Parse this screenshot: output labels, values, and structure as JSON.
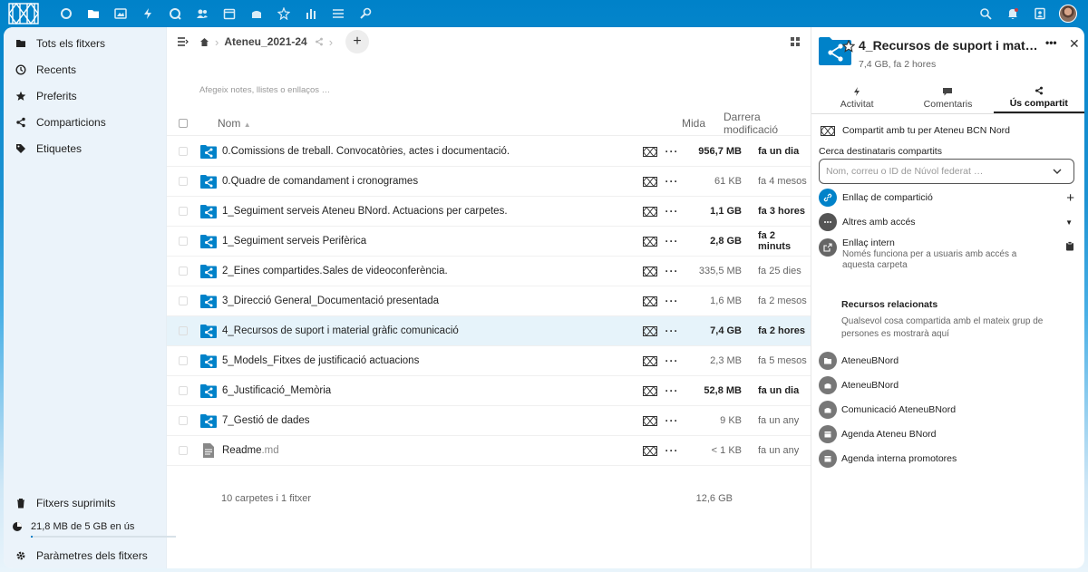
{
  "colors": {
    "accent": "#0082c9",
    "folder": "#0082c9",
    "selected_row": "#e6f3fa"
  },
  "topbar": {
    "apps": [
      "dashboard-icon",
      "files-icon",
      "photos-icon",
      "activity-icon",
      "talk-icon",
      "contacts-icon",
      "calendar-icon",
      "deck-icon",
      "forms-icon",
      "analytics-icon",
      "tasks-icon",
      "settings-icon"
    ],
    "right": [
      "search-icon",
      "notifications-icon",
      "contacts-menu-icon",
      "avatar"
    ]
  },
  "nav": {
    "items": [
      {
        "label": "Tots els fitxers",
        "icon": "folder-icon"
      },
      {
        "label": "Recents",
        "icon": "clock-icon"
      },
      {
        "label": "Preferits",
        "icon": "star-icon"
      },
      {
        "label": "Comparticions",
        "icon": "share-icon"
      },
      {
        "label": "Etiquetes",
        "icon": "tag-icon"
      }
    ],
    "deleted": "Fitxers suprimits",
    "quota": "21,8 MB de 5 GB en ús",
    "quota_fraction": 0.004,
    "settings": "Paràmetres dels fitxers"
  },
  "breadcrumb": {
    "folder": "Ateneu_2021-24"
  },
  "notes_placeholder": "Afegeix notes, llistes o enllaços …",
  "table": {
    "headers": {
      "name": "Nom",
      "size": "Mida",
      "modified": "Darrera modificació"
    },
    "rows": [
      {
        "name": "0.Comissions de treball. Convocatòries, actes i documentació.",
        "ext": "",
        "size": "956,7 MB",
        "modified": "fa un dia",
        "bold": true,
        "type": "shared-folder"
      },
      {
        "name": "0.Quadre de comandament i cronogrames",
        "ext": "",
        "size": "61 KB",
        "modified": "fa 4 mesos",
        "bold": false,
        "type": "shared-folder"
      },
      {
        "name": "1_Seguiment serveis Ateneu BNord. Actuacions per carpetes.",
        "ext": "",
        "size": "1,1 GB",
        "modified": "fa 3 hores",
        "bold": true,
        "type": "shared-folder"
      },
      {
        "name": "1_Seguiment serveis Perifèrica",
        "ext": "",
        "size": "2,8 GB",
        "modified": "fa 2 minuts",
        "bold": true,
        "type": "shared-folder"
      },
      {
        "name": "2_Eines compartides.Sales de videoconferència.",
        "ext": "",
        "size": "335,5 MB",
        "modified": "fa 25 dies",
        "bold": false,
        "type": "shared-folder"
      },
      {
        "name": "3_Direcció General_Documentació presentada",
        "ext": "",
        "size": "1,6 MB",
        "modified": "fa 2 mesos",
        "bold": false,
        "type": "shared-folder"
      },
      {
        "name": "4_Recursos de suport i material gràfic comunicació",
        "ext": "",
        "size": "7,4 GB",
        "modified": "fa 2 hores",
        "bold": true,
        "type": "shared-folder",
        "selected": true
      },
      {
        "name": "5_Models_Fitxes de justificació actuacions",
        "ext": "",
        "size": "2,3 MB",
        "modified": "fa 5 mesos",
        "bold": false,
        "type": "shared-folder"
      },
      {
        "name": "6_Justificació_Memòria",
        "ext": "",
        "size": "52,8 MB",
        "modified": "fa un dia",
        "bold": true,
        "type": "shared-folder"
      },
      {
        "name": "7_Gestió de dades",
        "ext": "",
        "size": "9 KB",
        "modified": "fa un any",
        "bold": false,
        "type": "shared-folder"
      },
      {
        "name": "Readme",
        "ext": ".md",
        "size": "< 1 KB",
        "modified": "fa un any",
        "bold": false,
        "type": "file"
      }
    ],
    "totals": {
      "summary": "10 carpetes i 1 fitxer",
      "size": "12,6 GB"
    }
  },
  "sidebar": {
    "title": "4_Recursos de suport i material gràfic comunicació",
    "subtitle": "7,4 GB, fa 2 hores",
    "tabs": [
      {
        "label": "Activitat",
        "icon": "activity-icon"
      },
      {
        "label": "Comentaris",
        "icon": "comment-icon"
      },
      {
        "label": "Ús compartit",
        "icon": "share-icon",
        "active": true
      }
    ],
    "shared_with": "Compartit amb tu per Ateneu BCN Nord",
    "search_label": "Cerca destinataris compartits",
    "search_placeholder": "Nom, correu o ID de Núvol federat …",
    "share_link": "Enllaç de compartició",
    "others_access": "Altres amb accés",
    "internal_link": "Enllaç intern",
    "internal_link_desc": "Només funciona per a usuaris amb accés a aquesta carpeta",
    "related_title": "Recursos relacionats",
    "related_desc": "Qualsevol cosa compartida amb el mateix grup de persones es mostrarà aquí",
    "related": [
      {
        "label": "AteneuBNord",
        "icon": "folder-icon"
      },
      {
        "label": "AteneuBNord",
        "icon": "deck-icon"
      },
      {
        "label": "Comunicació AteneuBNord",
        "icon": "deck-icon"
      },
      {
        "label": "Agenda Ateneu BNord",
        "icon": "calendar-icon"
      },
      {
        "label": "Agenda interna promotores",
        "icon": "calendar-icon"
      }
    ]
  }
}
